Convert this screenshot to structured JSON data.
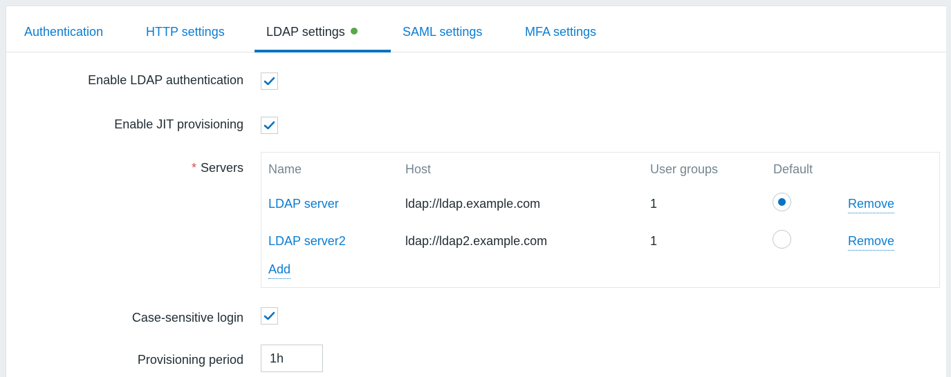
{
  "tabs": [
    {
      "label": "Authentication",
      "active": false
    },
    {
      "label": "HTTP settings",
      "active": false
    },
    {
      "label": "LDAP settings",
      "active": true,
      "indicator": "status-dot",
      "indicator_color": "#59a84b"
    },
    {
      "label": "SAML settings",
      "active": false
    },
    {
      "label": "MFA settings",
      "active": false
    }
  ],
  "form": {
    "enable_ldap": {
      "label": "Enable LDAP authentication",
      "checked": true
    },
    "enable_jit": {
      "label": "Enable JIT provisioning",
      "checked": true
    },
    "servers": {
      "required_marker": "*",
      "label": "Servers",
      "columns": [
        "Name",
        "Host",
        "User groups",
        "Default",
        ""
      ],
      "rows": [
        {
          "name": "LDAP server",
          "host": "ldap://ldap.example.com",
          "user_groups": "1",
          "default": true,
          "action": "Remove"
        },
        {
          "name": "LDAP server2",
          "host": "ldap://ldap2.example.com",
          "user_groups": "1",
          "default": false,
          "action": "Remove"
        }
      ],
      "add_label": "Add"
    },
    "case_sensitive": {
      "label": "Case-sensitive login",
      "checked": true
    },
    "provisioning_period": {
      "label": "Provisioning period",
      "value": "1h"
    }
  },
  "colors": {
    "link": "#0a7dd3",
    "accent": "#0b73c2",
    "required": "#d64e4e",
    "active_indicator": "#59a84b"
  },
  "icons": {
    "checkbox_check": "checkmark-icon"
  }
}
